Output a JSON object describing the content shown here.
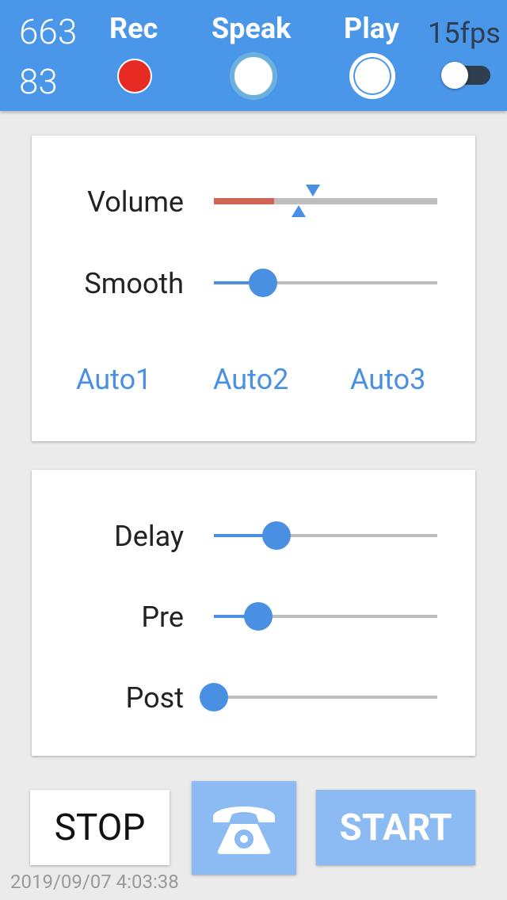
{
  "header": {
    "counter_top": "663",
    "counter_bottom": "83",
    "rec_label": "Rec",
    "speak_label": "Speak",
    "play_label": "Play",
    "fps_label": "15fps",
    "rec_indicator_color": "#e62b24",
    "fps_toggle_on": false
  },
  "card1": {
    "volume_label": "Volume",
    "smooth_label": "Smooth",
    "auto_buttons": [
      "Auto1",
      "Auto2",
      "Auto3"
    ],
    "volume_level_fraction": 0.27,
    "volume_marker_fraction": 0.41,
    "smooth_fraction": 0.22
  },
  "card2": {
    "delay_label": "Delay",
    "pre_label": "Pre",
    "post_label": "Post",
    "delay_fraction": 0.28,
    "pre_fraction": 0.2,
    "post_fraction": 0.0
  },
  "actions": {
    "stop_label": "STOP",
    "phone_icon": "phone-icon",
    "start_label": "START"
  },
  "footer": {
    "timestamp": "2019/09/07 4:03:38"
  }
}
